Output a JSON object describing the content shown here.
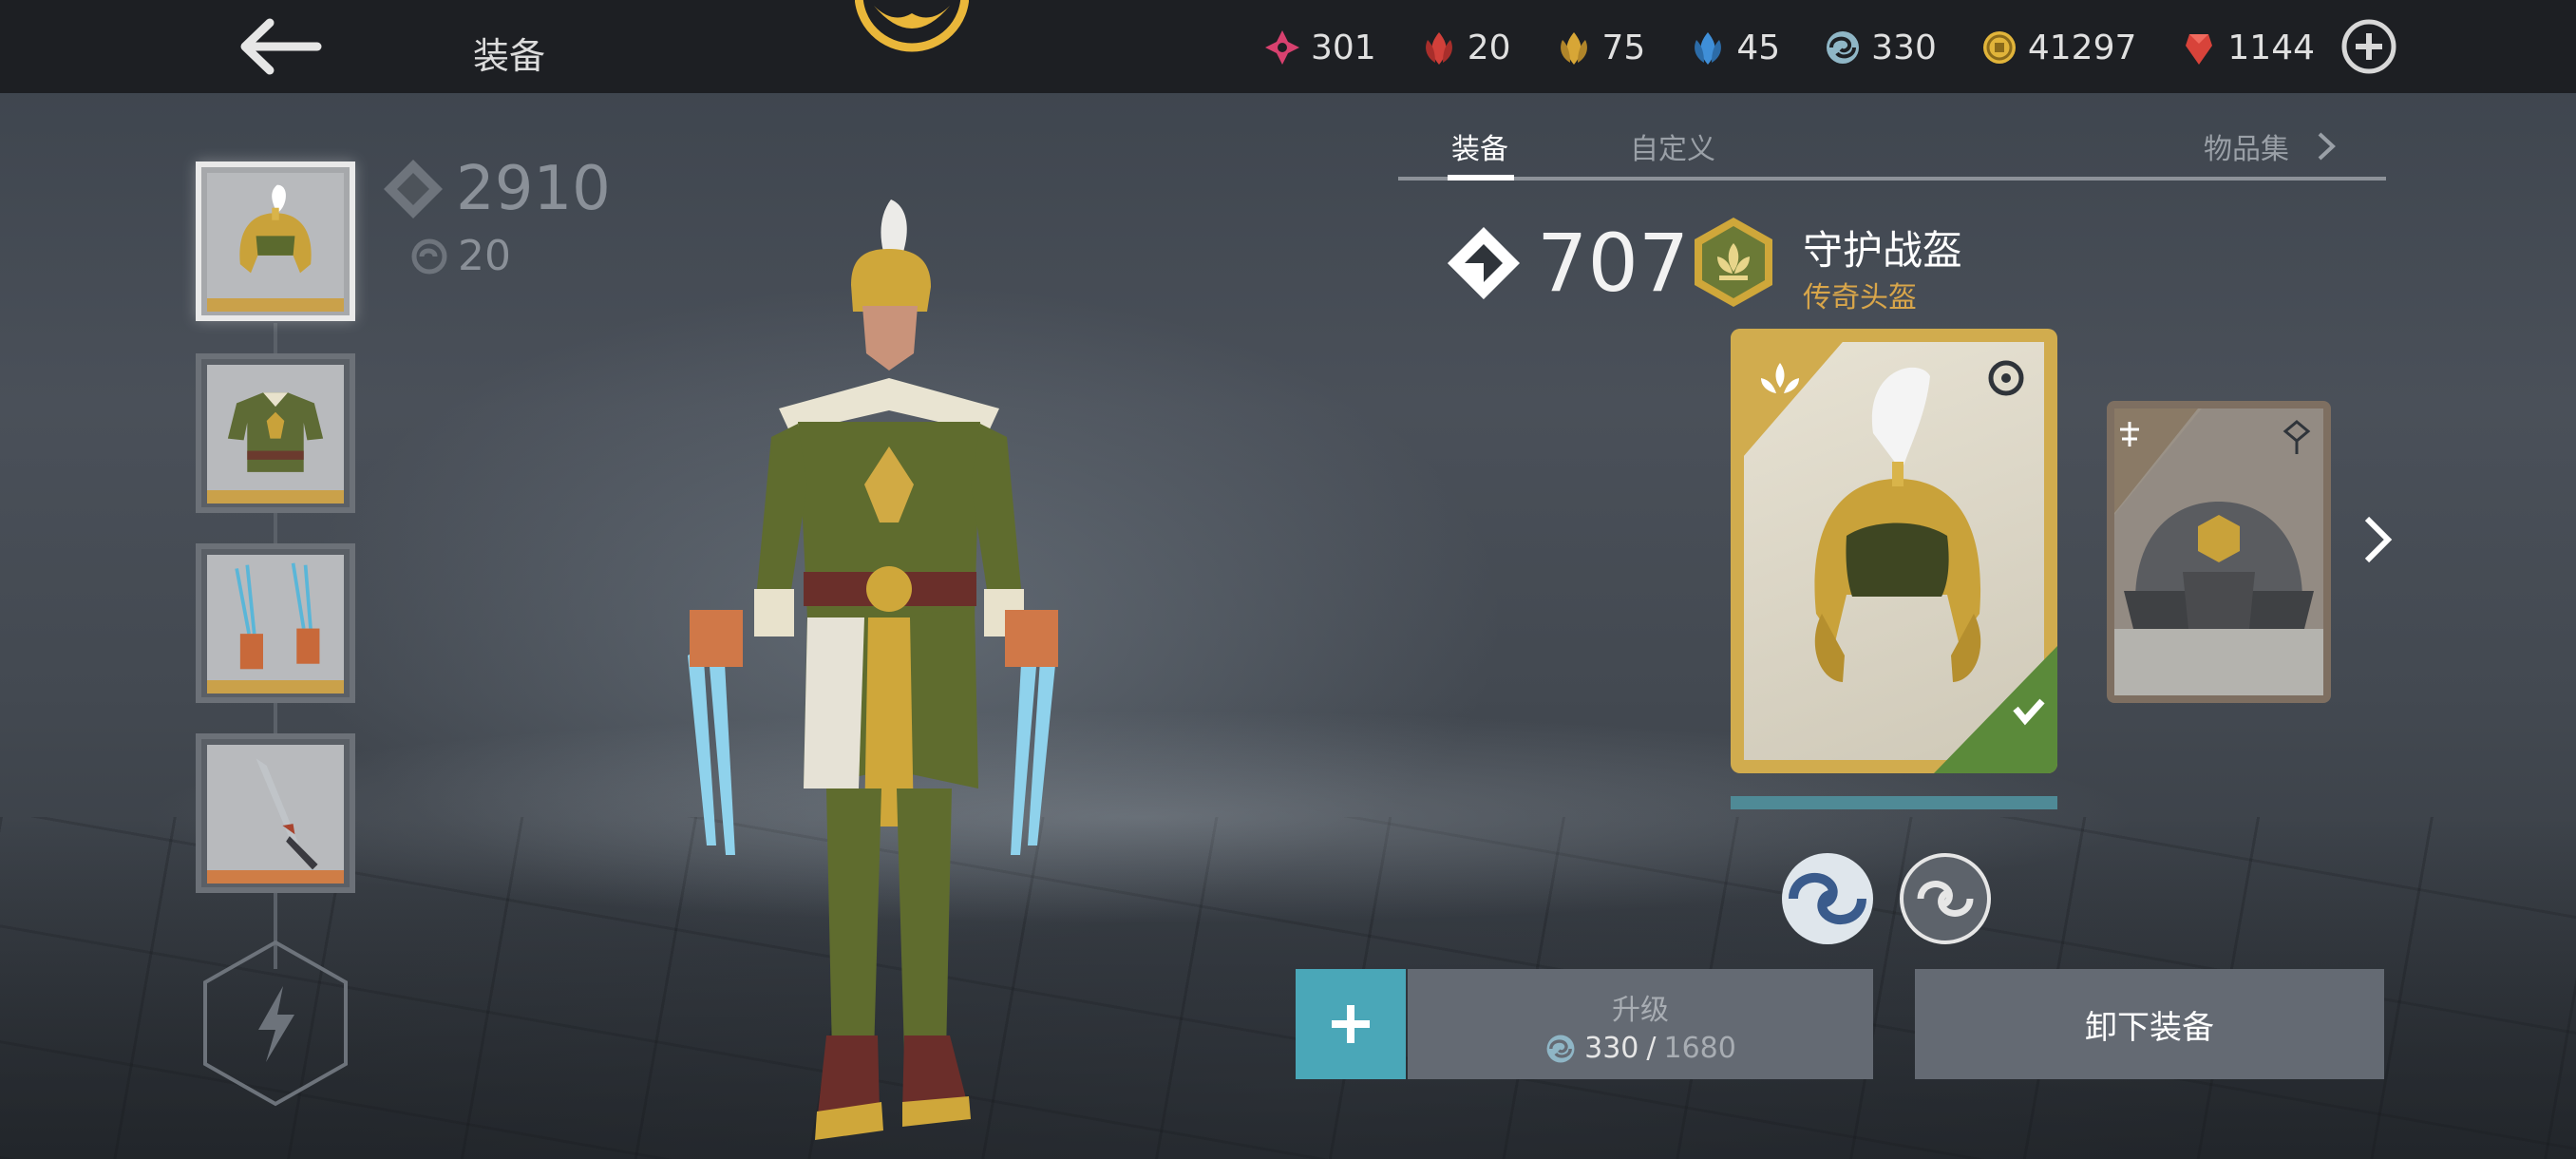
{
  "header": {
    "title": "装备"
  },
  "currencies": [
    {
      "icon": "pink-gem-icon",
      "value": "301",
      "color": "#d8416f"
    },
    {
      "icon": "red-leaf-icon",
      "value": "20",
      "color": "#d1403a"
    },
    {
      "icon": "gold-leaf-icon",
      "value": "75",
      "color": "#d7a636"
    },
    {
      "icon": "blue-leaf-icon",
      "value": "45",
      "color": "#3f8fd8"
    },
    {
      "icon": "swirl-icon",
      "value": "330",
      "color": "#8fb6c6"
    },
    {
      "icon": "coin-icon",
      "value": "41297",
      "color": "#e1b43a"
    },
    {
      "icon": "ruby-icon",
      "value": "1144",
      "color": "#d8433a"
    }
  ],
  "left_panel": {
    "gear_score": "2910",
    "gear_sub": "20",
    "slots": [
      {
        "name": "helmet",
        "icon": "helmet-icon",
        "selected": true
      },
      {
        "name": "armor",
        "icon": "armor-icon",
        "selected": false
      },
      {
        "name": "claws",
        "icon": "claws-icon",
        "selected": false
      },
      {
        "name": "weapon",
        "icon": "weapon-icon",
        "selected": false
      }
    ]
  },
  "tabs": {
    "equip": "装备",
    "custom": "自定义",
    "collection": "物品集"
  },
  "item": {
    "power": "707",
    "name": "守护战盔",
    "rarity": "传奇头盔",
    "equipped": true
  },
  "actions": {
    "upgrade_label": "升级",
    "upgrade_current": "330",
    "upgrade_separator": "/",
    "upgrade_required": "1680",
    "unequip_label": "卸下装备"
  },
  "colors": {
    "accent_teal": "#4aa7b8",
    "legendary_gold": "#d1ac4e",
    "rarity_text": "#d9a64a",
    "button_bg": "#646a73"
  }
}
